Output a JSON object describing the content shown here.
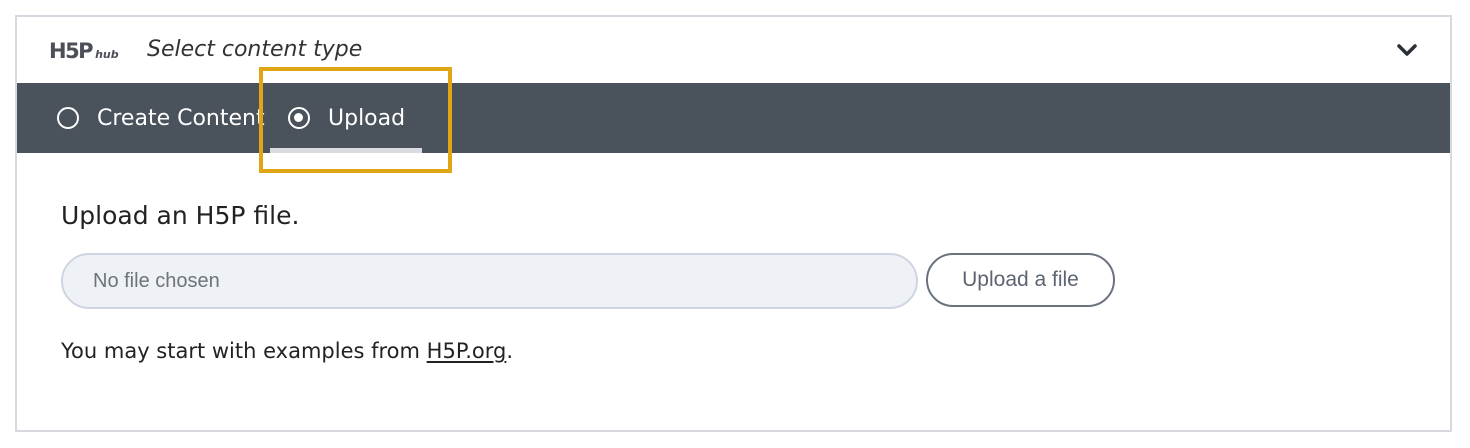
{
  "header": {
    "logo_main": "H5P",
    "logo_sub": "hub",
    "title": "Select content type",
    "collapse_icon": "chevron-down-icon"
  },
  "tabs": [
    {
      "label": "Create Content",
      "selected": false
    },
    {
      "label": "Upload",
      "selected": true
    }
  ],
  "upload": {
    "title": "Upload an H5P file.",
    "file_placeholder": "No file chosen",
    "button_label": "Upload a file",
    "examples_prefix": "You may start with examples from ",
    "examples_link": "H5P.org",
    "examples_suffix": "."
  },
  "colors": {
    "tabbar_bg": "#4a525c",
    "highlight": "#e2a615",
    "field_bg": "#eef1f5"
  }
}
